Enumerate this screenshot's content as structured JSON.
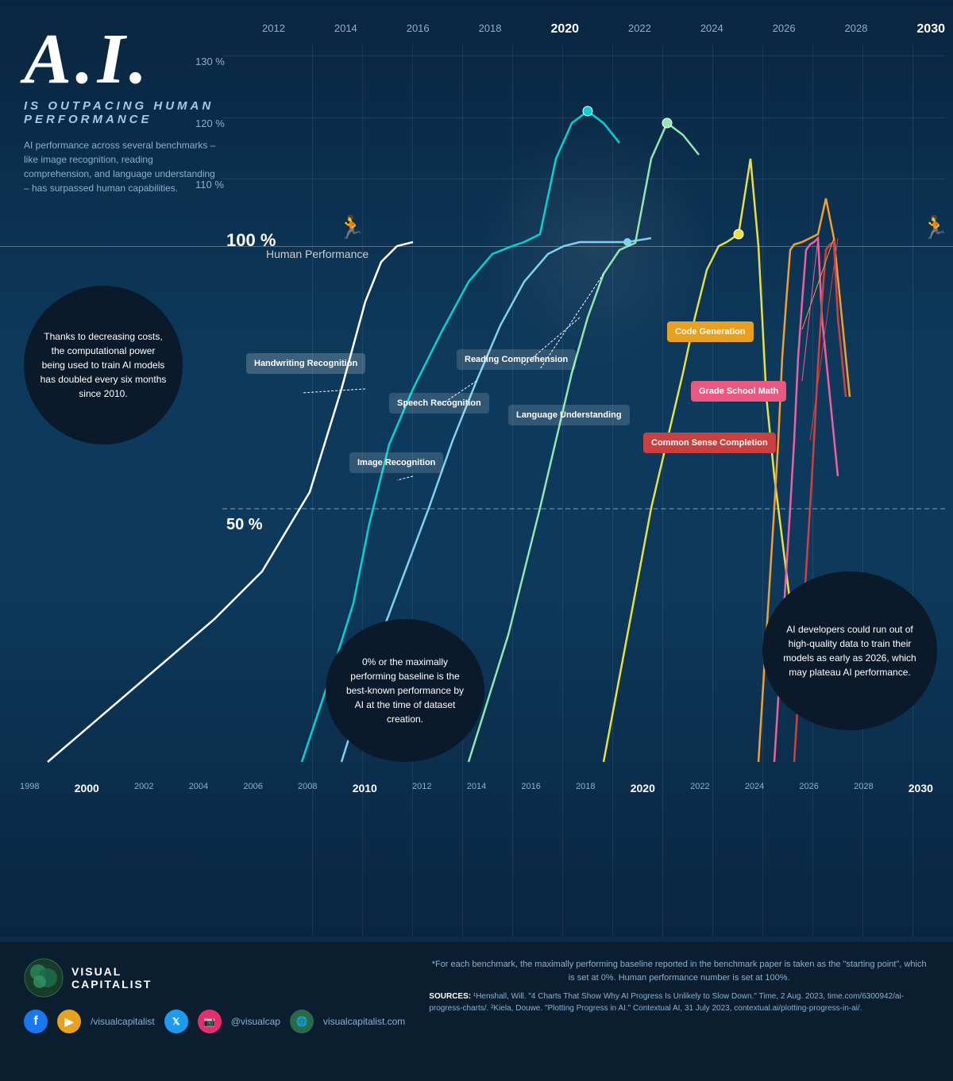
{
  "title": {
    "main": "A.I.",
    "subtitle": "IS OUTPACING HUMAN PERFORMANCE",
    "description": "AI performance across several benchmarks – like image recognition, reading comprehension, and language understanding – has surpassed human capabilities."
  },
  "years_top": [
    "2012",
    "2014",
    "2016",
    "2018",
    "2020",
    "2022",
    "2024",
    "2026",
    "2028",
    "2030"
  ],
  "years_bottom": [
    "1998",
    "2000",
    "2002",
    "2004",
    "2006",
    "2008",
    "2010",
    "2012",
    "2014",
    "2016",
    "2018",
    "2020",
    "2022",
    "2024",
    "2026",
    "2028",
    "2030"
  ],
  "pct_labels": {
    "p130": "130 %",
    "p120": "120 %",
    "p110": "110 %",
    "p100": "100 %",
    "p100_label": "Human Performance",
    "p50": "50 %"
  },
  "benchmarks": {
    "handwriting": "Handwriting\nRecognition",
    "image": "Image\nRecognition",
    "speech": "Speech\nRecognition",
    "reading": "Reading\nComprehension",
    "language": "Language\nUnderstanding",
    "code_gen": "Code\nGeneration",
    "grade_math": "Grade School\nMath",
    "common_sense": "Common Sense\nCompletion"
  },
  "callouts": {
    "left": "Thanks to decreasing costs, the computational power being used to train AI models has doubled every six months since 2010.",
    "center": "0% or the maximally performing baseline is the best-known performance by AI at the time of dataset creation.",
    "bottom_right": "AI developers could run out of high-quality data to train their models as early as 2026, which may plateau AI performance."
  },
  "footer": {
    "logo_line1": "VISUAL",
    "logo_line2": "CAPITALIST",
    "social_facebook": "/visualcapitalist",
    "social_twitter": "@visualcap",
    "social_web": "visualcapitalist.com",
    "footnote": "*For each benchmark, the maximally performing baseline reported in the benchmark paper is taken as the \"starting point\", which is set at 0%. Human performance number is set at 100%.",
    "sources_label": "SOURCES:",
    "sources_text": " ¹Henshall, Will. \"4 Charts That Show Why AI Progress Is Unlikely to Slow Down.\" Time, 2 Aug. 2023, time.com/6300942/ai-progress-charts/. ²Kiela, Douwe. \"Plotting Progress in AI.\" Contextual AI, 31 July 2023, contextual.ai/plotting-progress-in-ai/."
  }
}
